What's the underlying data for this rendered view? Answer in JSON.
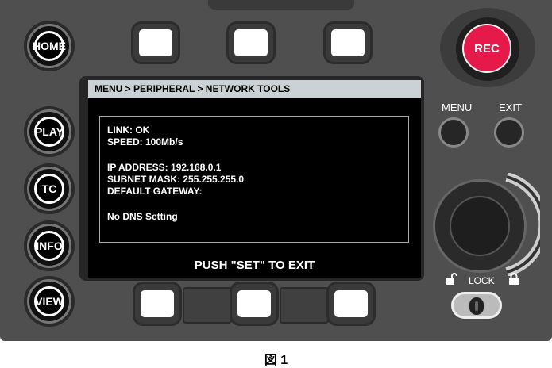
{
  "screen": {
    "breadcrumb": "MENU > PERIPHERAL  > NETWORK TOOLS",
    "lines": [
      "LINK: OK",
      "SPEED: 100Mb/s",
      "IP ADDRESS: 192.168.0.1",
      "SUBNET MASK: 255.255.255.0",
      "DEFAULT GATEWAY:",
      "No DNS Setting"
    ],
    "footer": "PUSH \"SET\" TO EXIT"
  },
  "side_buttons": [
    "HOME",
    "PLAY",
    "TC",
    "INFO",
    "VIEW"
  ],
  "controls": {
    "rec_label": "REC",
    "menu_label": "MENU",
    "exit_label": "EXIT",
    "lock_label": "LOCK"
  },
  "caption": "図 1",
  "colors": {
    "panel": "#4f4f4f",
    "rec": "#e5194a",
    "screen_header": "#cbd2d5"
  },
  "icons": {
    "unlock": "unlock-icon",
    "lock": "lock-icon"
  }
}
